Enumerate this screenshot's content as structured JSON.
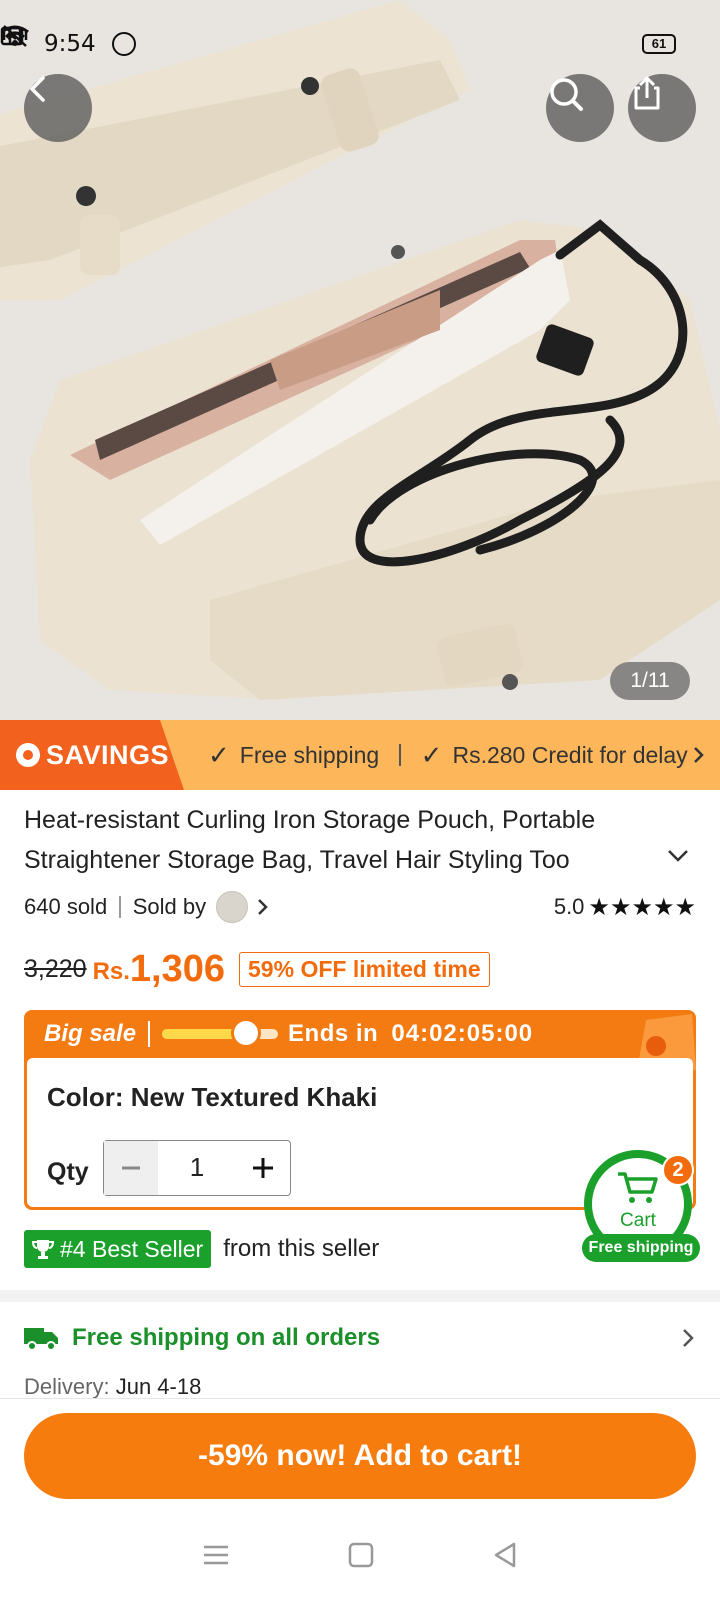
{
  "status_bar": {
    "time": "9:54",
    "battery": "61"
  },
  "gallery": {
    "counter": "1/11"
  },
  "savings_strip": {
    "tag": "SAVINGS",
    "items": [
      "Free shipping",
      "Rs.280 Credit for delay"
    ]
  },
  "product": {
    "title": "Heat-resistant Curling Iron Storage Pouch, Portable Straightener Storage Bag, Travel Hair Styling Too",
    "sold": "640 sold",
    "sold_by": "Sold by",
    "rating": "5.0",
    "rating_stars": 5,
    "old_price": "3,220",
    "currency": "Rs.",
    "price": "1,306",
    "discount": "59% OFF limited time"
  },
  "big_sale": {
    "label": "Big sale",
    "ends_label": "Ends in",
    "countdown": "04:02:05:00",
    "progress": 0.72,
    "color_line": "Color: New Textured Khaki",
    "qty_label": "Qty",
    "qty_value": "1"
  },
  "best_seller": {
    "badge": "#4 Best Seller",
    "suffix": "from this seller"
  },
  "cart": {
    "label": "Cart",
    "count": "2",
    "free_shipping": "Free shipping"
  },
  "shipping": {
    "headline": "Free shipping on all orders",
    "delivery_label": "Delivery:",
    "delivery_value": "Jun 4-18"
  },
  "cta": {
    "label": "-59% now! Add to cart!"
  },
  "colors": {
    "accent": "#f77c0e",
    "green": "#1aa02b",
    "savings_bg": "#fdb65a"
  }
}
